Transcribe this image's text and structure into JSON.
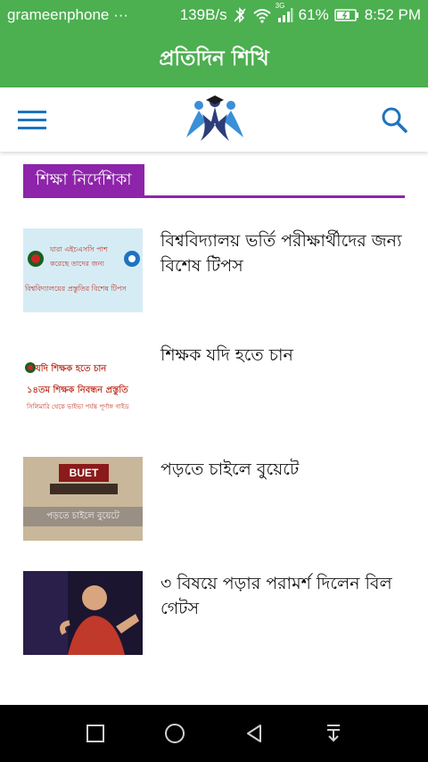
{
  "status_bar": {
    "carrier": "grameenphone ···",
    "speed": "139B/s",
    "battery": "61%",
    "time": "8:52 PM",
    "network_label": "3G",
    "icons": [
      "bluetooth-icon",
      "wifi-icon",
      "signal-icon",
      "battery-icon"
    ]
  },
  "app_title": "প্রতিদিন শিখি",
  "toolbar": {
    "menu_icon": "hamburger-menu-icon",
    "logo": "graduates-logo",
    "search_icon": "search-icon"
  },
  "section": {
    "heading": "শিক্ষা নির্দেশিকা"
  },
  "articles": [
    {
      "title": "বিশ্ববিদ্যালয় ভর্তি পরীক্ষার্থীদের জন্য বিশেষ টিপস",
      "thumb_lines": [
        "যারা এইচএসসি পাশ",
        "করেছে তাদের জন্য",
        "বিশ্ববিদ্যালয়ের প্রস্তুতির বিশেষ টিপস"
      ]
    },
    {
      "title": "শিক্ষক যদি হতে চান",
      "thumb_lines": [
        "যদি শিক্ষক হতে চান",
        "১৪তম শিক্ষক নিবন্ধন প্রস্তুতি",
        "সিলিমারি থেকে ভাইভা পর্যন্ত পূর্ণাঙ্গ গাইড"
      ]
    },
    {
      "title": "পড়তে চাইলে বুয়েটে",
      "thumb_lines": [
        "BUET",
        "পড়তে চাইলে বুয়েটে"
      ]
    },
    {
      "title": "৩ বিষয়ে পড়ার পরামর্শ দিলেন বিল গেটস",
      "thumb_lines": []
    }
  ],
  "colors": {
    "app_bar": "#4caf50",
    "accent": "#8e24aa",
    "icon_blue": "#1e73be"
  },
  "nav_bar": {
    "buttons": [
      "recents-square-icon",
      "home-circle-icon",
      "back-triangle-icon",
      "notification-pull-icon"
    ]
  }
}
